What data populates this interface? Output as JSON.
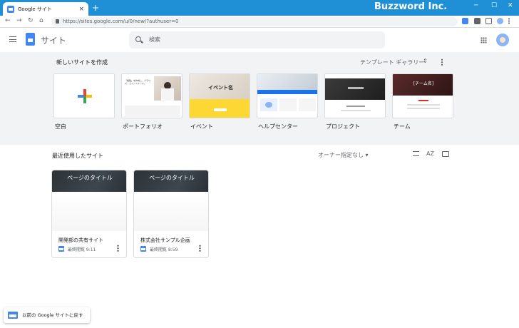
{
  "browser": {
    "tab_title": "Google サイト",
    "tab_close": "×",
    "new_tab": "+",
    "brand": "Buzzword Inc.",
    "window_buttons": [
      "─",
      "☐",
      "✕"
    ],
    "nav_buttons": [
      "←",
      "→",
      "↻",
      "⌂"
    ],
    "url": "https://sites.google.com/u/0/new/?authuser=0",
    "accent_color": "#1f8fd6"
  },
  "appbar": {
    "title": "サイト",
    "search_placeholder": "検索"
  },
  "templates": {
    "heading": "新しいサイトを作成",
    "gallery_label": "テンプレート ギャラリー",
    "gallery_toggle": "⇕",
    "items": [
      {
        "label": "空白",
        "thumb_text": ""
      },
      {
        "label": "ポートフォリオ",
        "thumb_text": "「複製」を作成し、ブラウズ・でインストール。"
      },
      {
        "label": "イベント",
        "thumb_text": "イベント名"
      },
      {
        "label": "ヘルプセンター",
        "thumb_text": ""
      },
      {
        "label": "プロジェクト",
        "thumb_text": ""
      },
      {
        "label": "チーム",
        "thumb_text": "[チーム名]"
      }
    ]
  },
  "recent": {
    "heading": "最近使用したサイト",
    "owner_filter": "オーナー指定なし",
    "sort_icon_text": "AZ",
    "sites": [
      {
        "banner_title": "ページのタイトル",
        "name": "開発部の共有サイト",
        "time": "最終閲覧 9:11"
      },
      {
        "banner_title": "ページのタイトル",
        "name": "株式会社サンプル企画",
        "time": "最終閲覧 8:59"
      }
    ]
  },
  "legacy_link": "以前の Google サイトに戻す"
}
